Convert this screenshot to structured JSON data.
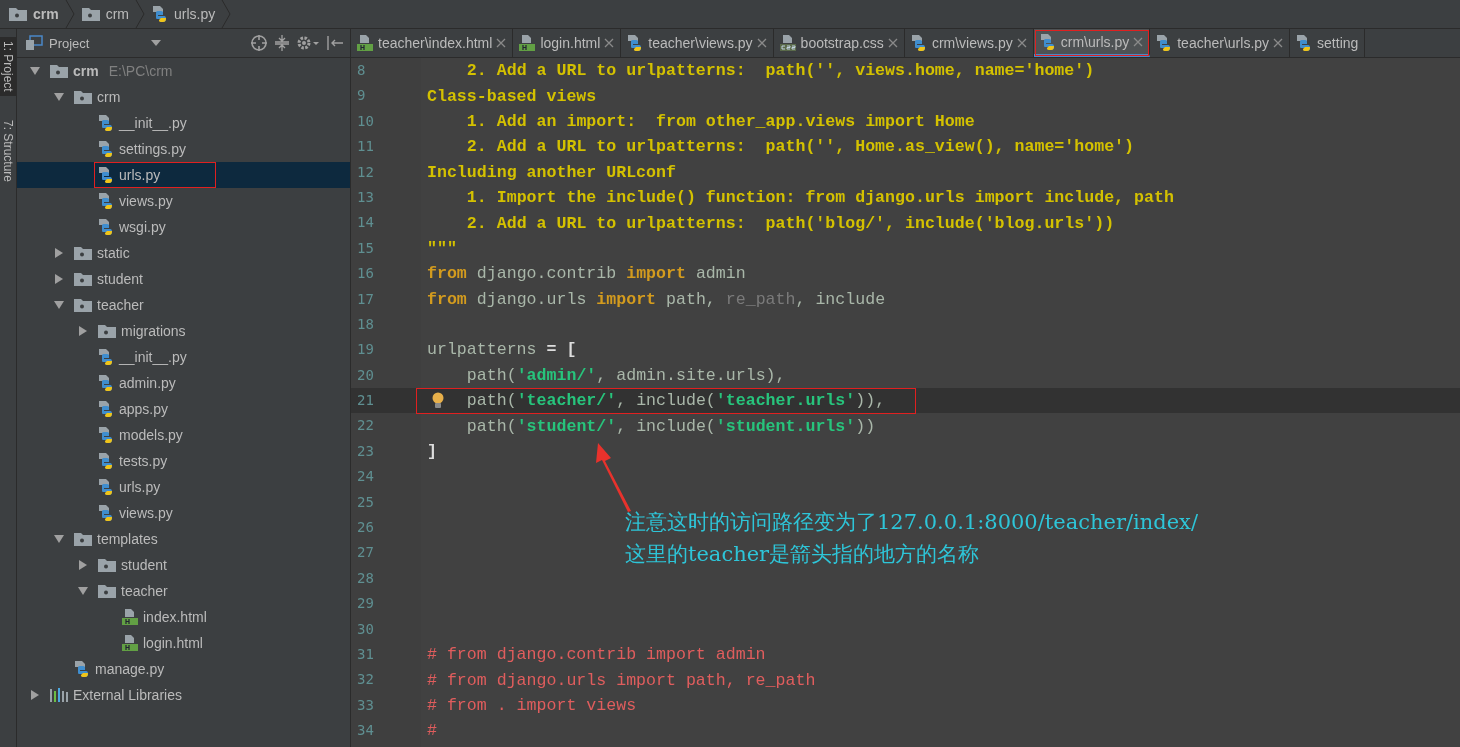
{
  "breadcrumb": [
    {
      "label": "crm",
      "kind": "folder",
      "bold": true
    },
    {
      "label": "crm",
      "kind": "folder",
      "bold": false
    },
    {
      "label": "urls.py",
      "kind": "python",
      "bold": false
    }
  ],
  "tool_strip": [
    {
      "label": "1: Project",
      "selected": true
    },
    {
      "label": "7: Structure",
      "selected": false
    }
  ],
  "project_panel": {
    "title": "Project"
  },
  "tree": [
    {
      "label": "crm",
      "path": "E:\\PC\\crm",
      "kind": "folder",
      "expanded": true,
      "selected": false,
      "annotated": false,
      "children": [
        {
          "label": "crm",
          "kind": "folder",
          "expanded": true,
          "selected": false,
          "annotated": false,
          "children": [
            {
              "label": "__init__.py",
              "kind": "python",
              "selected": false,
              "annotated": false
            },
            {
              "label": "settings.py",
              "kind": "python",
              "selected": false,
              "annotated": false
            },
            {
              "label": "urls.py",
              "kind": "python",
              "selected": true,
              "annotated": true
            },
            {
              "label": "views.py",
              "kind": "python",
              "selected": false,
              "annotated": false
            },
            {
              "label": "wsgi.py",
              "kind": "python",
              "selected": false,
              "annotated": false
            }
          ]
        },
        {
          "label": "static",
          "kind": "folder",
          "expanded": false,
          "selected": false,
          "annotated": false
        },
        {
          "label": "student",
          "kind": "folder",
          "expanded": false,
          "selected": false,
          "annotated": false
        },
        {
          "label": "teacher",
          "kind": "folder",
          "expanded": true,
          "selected": false,
          "annotated": false,
          "children": [
            {
              "label": "migrations",
              "kind": "folder",
              "expanded": false,
              "selected": false,
              "annotated": false
            },
            {
              "label": "__init__.py",
              "kind": "python",
              "selected": false,
              "annotated": false
            },
            {
              "label": "admin.py",
              "kind": "python",
              "selected": false,
              "annotated": false
            },
            {
              "label": "apps.py",
              "kind": "python",
              "selected": false,
              "annotated": false
            },
            {
              "label": "models.py",
              "kind": "python",
              "selected": false,
              "annotated": false
            },
            {
              "label": "tests.py",
              "kind": "python",
              "selected": false,
              "annotated": false
            },
            {
              "label": "urls.py",
              "kind": "python",
              "selected": false,
              "annotated": false
            },
            {
              "label": "views.py",
              "kind": "python",
              "selected": false,
              "annotated": false
            }
          ]
        },
        {
          "label": "templates",
          "kind": "folder",
          "expanded": true,
          "selected": false,
          "annotated": false,
          "children": [
            {
              "label": "student",
              "kind": "folder",
              "expanded": false,
              "selected": false,
              "annotated": false
            },
            {
              "label": "teacher",
              "kind": "folder",
              "expanded": true,
              "selected": false,
              "annotated": false,
              "children": [
                {
                  "label": "index.html",
                  "kind": "html",
                  "selected": false,
                  "annotated": false
                },
                {
                  "label": "login.html",
                  "kind": "html",
                  "selected": false,
                  "annotated": false
                }
              ]
            }
          ]
        },
        {
          "label": "manage.py",
          "kind": "python",
          "selected": false,
          "annotated": false
        }
      ]
    },
    {
      "label": "External Libraries",
      "kind": "libraries",
      "expanded": false,
      "selected": false,
      "annotated": false
    }
  ],
  "tabs": [
    {
      "label": "teacher\\index.html",
      "kind": "html",
      "selected": false,
      "annotated": false,
      "closable": true
    },
    {
      "label": "login.html",
      "kind": "html",
      "selected": false,
      "annotated": false,
      "closable": true
    },
    {
      "label": "teacher\\views.py",
      "kind": "python",
      "selected": false,
      "annotated": false,
      "closable": true
    },
    {
      "label": "bootstrap.css",
      "kind": "css",
      "selected": false,
      "annotated": false,
      "closable": true
    },
    {
      "label": "crm\\views.py",
      "kind": "python",
      "selected": false,
      "annotated": false,
      "closable": true
    },
    {
      "label": "crm\\urls.py",
      "kind": "python",
      "selected": true,
      "annotated": true,
      "closable": true
    },
    {
      "label": "teacher\\urls.py",
      "kind": "python",
      "selected": false,
      "annotated": false,
      "closable": true
    },
    {
      "label": "setting",
      "kind": "python",
      "selected": false,
      "annotated": false,
      "closable": false
    }
  ],
  "code_lines": [
    {
      "number": "8",
      "current": false,
      "annotated": false,
      "tokens": [
        {
          "kind": "doc",
          "text": "    2. Add a URL to urlpatterns:  path('', views.home, name='home')"
        }
      ]
    },
    {
      "number": "9",
      "current": false,
      "annotated": false,
      "tokens": [
        {
          "kind": "doc",
          "text": "Class-based views"
        }
      ]
    },
    {
      "number": "10",
      "current": false,
      "annotated": false,
      "tokens": [
        {
          "kind": "doc",
          "text": "    1. Add an import:  from other_app.views import Home"
        }
      ]
    },
    {
      "number": "11",
      "current": false,
      "annotated": false,
      "tokens": [
        {
          "kind": "doc",
          "text": "    2. Add a URL to urlpatterns:  path('', Home.as_view(), name='home')"
        }
      ]
    },
    {
      "number": "12",
      "current": false,
      "annotated": false,
      "tokens": [
        {
          "kind": "doc",
          "text": "Including another URLconf"
        }
      ]
    },
    {
      "number": "13",
      "current": false,
      "annotated": false,
      "tokens": [
        {
          "kind": "doc",
          "text": "    1. Import the include() function: from django.urls import include, path"
        }
      ]
    },
    {
      "number": "14",
      "current": false,
      "annotated": false,
      "tokens": [
        {
          "kind": "doc",
          "text": "    2. Add a URL to urlpatterns:  path('blog/', include('blog.urls'))"
        }
      ]
    },
    {
      "number": "15",
      "current": false,
      "annotated": false,
      "tokens": [
        {
          "kind": "doc",
          "text": "\"\"\""
        }
      ]
    },
    {
      "number": "16",
      "current": false,
      "annotated": false,
      "tokens": [
        {
          "kind": "kw",
          "text": "from"
        },
        {
          "kind": "plain",
          "text": " django.contrib "
        },
        {
          "kind": "kw",
          "text": "import"
        },
        {
          "kind": "plain",
          "text": " admin"
        }
      ]
    },
    {
      "number": "17",
      "current": false,
      "annotated": false,
      "tokens": [
        {
          "kind": "kw",
          "text": "from"
        },
        {
          "kind": "plain",
          "text": " django.urls "
        },
        {
          "kind": "kw",
          "text": "import"
        },
        {
          "kind": "plain",
          "text": " path, "
        },
        {
          "kind": "dim",
          "text": "re_path"
        },
        {
          "kind": "plain",
          "text": ", include"
        }
      ]
    },
    {
      "number": "18",
      "current": false,
      "annotated": false
    },
    {
      "number": "19",
      "current": false,
      "annotated": false,
      "tokens": [
        {
          "kind": "plain",
          "text": "urlpatterns "
        },
        {
          "kind": "punct",
          "text": "= ["
        }
      ]
    },
    {
      "number": "20",
      "current": false,
      "annotated": false,
      "tokens": [
        {
          "kind": "plain",
          "text": "    path("
        },
        {
          "kind": "str",
          "text": "'admin/'"
        },
        {
          "kind": "plain",
          "text": ", admin.site.urls),"
        }
      ]
    },
    {
      "number": "21",
      "current": true,
      "annotated": true,
      "hint": true,
      "tokens": [
        {
          "kind": "plain",
          "text": "    path("
        },
        {
          "kind": "str",
          "text": "'teacher/'"
        },
        {
          "kind": "plain",
          "text": ", include("
        },
        {
          "kind": "str",
          "text": "'teacher.urls'"
        },
        {
          "kind": "plain",
          "text": ")),"
        }
      ]
    },
    {
      "number": "22",
      "current": false,
      "annotated": false,
      "tokens": [
        {
          "kind": "plain",
          "text": "    path("
        },
        {
          "kind": "str",
          "text": "'student/'"
        },
        {
          "kind": "plain",
          "text": ", include("
        },
        {
          "kind": "str",
          "text": "'student.urls'"
        },
        {
          "kind": "plain",
          "text": "))"
        }
      ]
    },
    {
      "number": "23",
      "current": false,
      "annotated": false,
      "tokens": [
        {
          "kind": "punct",
          "text": "]"
        }
      ]
    },
    {
      "number": "24",
      "current": false,
      "annotated": false
    },
    {
      "number": "25",
      "current": false,
      "annotated": false
    },
    {
      "number": "26",
      "current": false,
      "annotated": false
    },
    {
      "number": "27",
      "current": false,
      "annotated": false
    },
    {
      "number": "28",
      "current": false,
      "annotated": false
    },
    {
      "number": "29",
      "current": false,
      "annotated": false
    },
    {
      "number": "30",
      "current": false,
      "annotated": false
    },
    {
      "number": "31",
      "current": false,
      "annotated": false,
      "tokens": [
        {
          "kind": "comment",
          "text": "# from django.contrib import admin"
        }
      ]
    },
    {
      "number": "32",
      "current": false,
      "annotated": false,
      "tokens": [
        {
          "kind": "comment",
          "text": "# from django.urls import path, re_path"
        }
      ]
    },
    {
      "number": "33",
      "current": false,
      "annotated": false,
      "tokens": [
        {
          "kind": "comment",
          "text": "# from . import views"
        }
      ]
    },
    {
      "number": "34",
      "current": false,
      "annotated": false,
      "tokens": [
        {
          "kind": "comment",
          "text": "#"
        }
      ]
    }
  ],
  "annotation": {
    "lines": [
      "注意这时的访问路径变为了127.0.0.1:8000/teacher/index/",
      "这里的teacher是箭头指的地方的名称"
    ]
  }
}
